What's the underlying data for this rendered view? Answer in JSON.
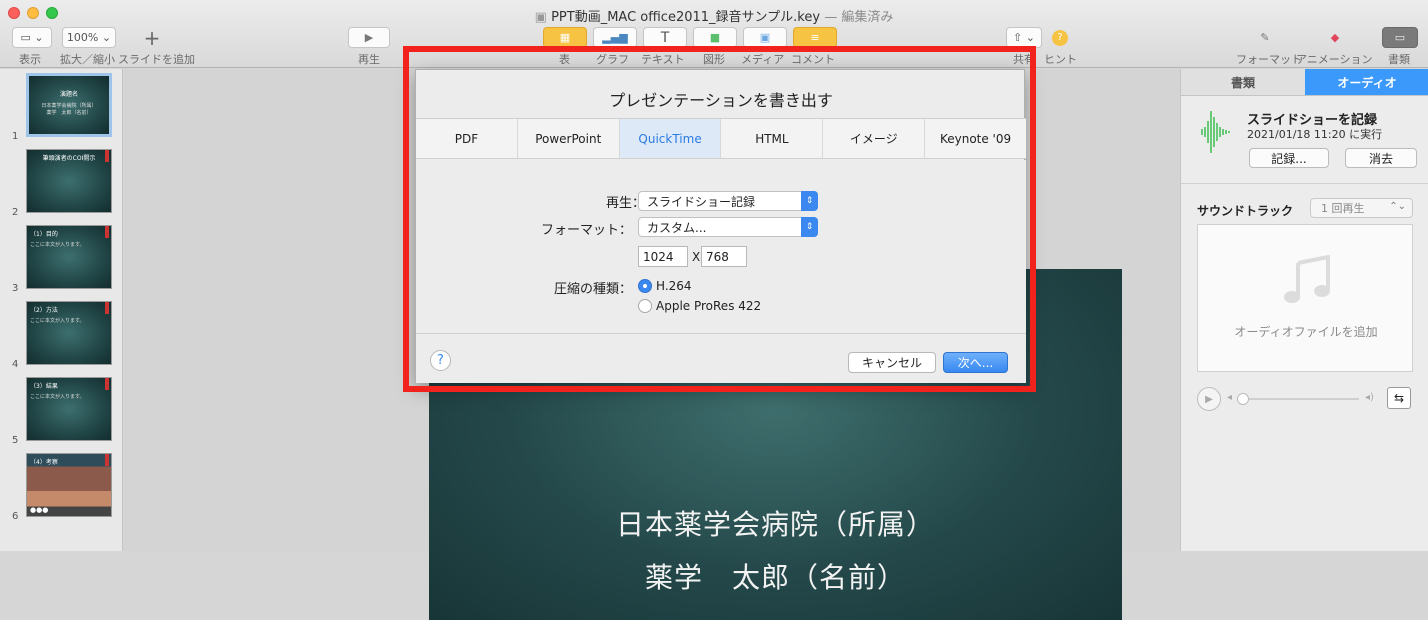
{
  "window": {
    "title": "PPT動画_MAC office2011_録音サンプル.key",
    "title_suffix": "— 編集済み"
  },
  "toolbar": {
    "view_label": "表示",
    "zoom_value": "100%",
    "zoom_label": "拡大／縮小",
    "add_slide_label": "スライドを追加",
    "play_label": "再生",
    "table_label": "表",
    "chart_label": "グラフ",
    "text_label": "テキスト",
    "shape_label": "図形",
    "media_label": "メディア",
    "comment_label": "コメント",
    "share_label": "共有",
    "hint_label": "ヒント",
    "format_label": "フォーマット",
    "animate_label": "アニメーション",
    "document_label": "書類"
  },
  "sidebar": {
    "slides": [
      {
        "num": "1",
        "title": "演題名",
        "lines": [
          "日本薬学会病院（所属）",
          "薬学　太郎（名前）"
        ]
      },
      {
        "num": "2",
        "title": "筆頭演者のCOI開示",
        "lines": []
      },
      {
        "num": "3",
        "title": "（1）目的",
        "lines": [
          "ここに本文が入ります。"
        ]
      },
      {
        "num": "4",
        "title": "（2）方法",
        "lines": [
          "ここに本文が入ります。"
        ]
      },
      {
        "num": "5",
        "title": "（3）結果",
        "lines": [
          "ここに本文が入ります。"
        ]
      },
      {
        "num": "6",
        "title": "（4）考察",
        "lines": []
      }
    ]
  },
  "slide": {
    "line1": "日本薬学会病院（所属）",
    "line2": "薬学　太郎（名前）"
  },
  "dialog": {
    "title": "プレゼンテーションを書き出す",
    "tabs": [
      "PDF",
      "PowerPoint",
      "QuickTime",
      "HTML",
      "イメージ",
      "Keynote '09"
    ],
    "active_tab": "QuickTime",
    "playback_label": "再生：",
    "playback_value": "スライドショー記録",
    "format_label": "フォーマット：",
    "format_value": "カスタム...",
    "width": "1024",
    "x_label": "X",
    "height": "768",
    "compression_label": "圧縮の種類：",
    "compression_options": [
      "H.264",
      "Apple ProRes 422"
    ],
    "compression_selected": "H.264",
    "help": "?",
    "cancel_label": "キャンセル",
    "next_label": "次へ..."
  },
  "inspector": {
    "tab_document": "書類",
    "tab_audio": "オーディオ",
    "record_title": "スライドショーを記録",
    "record_date": "2021/01/18 11:20 に実行",
    "record_button": "記録...",
    "delete_button": "消去",
    "soundtrack_label": "サウンドトラック",
    "soundtrack_value": "1 回再生",
    "drop_text": "オーディオファイルを追加"
  },
  "colors": {
    "accent": "#3b89f0",
    "highlight": "#f2231d",
    "slide_bg": "#24484a"
  }
}
